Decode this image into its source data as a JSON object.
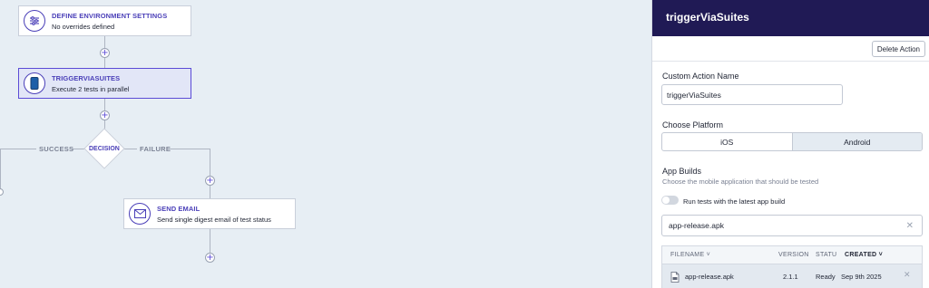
{
  "flow": {
    "nodes": [
      {
        "title": "DEFINE ENVIRONMENT SETTINGS",
        "subtitle": "No overrides defined",
        "icon": "sliders-icon"
      },
      {
        "title": "TRIGGERVIASUITES",
        "subtitle": "Execute 2 tests in parallel",
        "icon": "phone-icon"
      },
      {
        "title": "SEND EMAIL",
        "subtitle": "Send single digest email of test status",
        "icon": "envelope-icon"
      }
    ],
    "decision": {
      "label": "DECISION",
      "success_label": "SUCCESS",
      "failure_label": "FAILURE"
    },
    "add_step_glyph": "+"
  },
  "panel": {
    "title": "triggerViaSuites",
    "delete_button": "Delete Action",
    "custom_action_name": {
      "label": "Custom Action Name",
      "value": "triggerViaSuites"
    },
    "platform": {
      "label": "Choose Platform",
      "options": [
        "iOS",
        "Android"
      ],
      "selected": "Android"
    },
    "app_builds": {
      "label": "App Builds",
      "hint": "Choose the mobile application that should be tested",
      "toggle_label": "Run tests with the latest app build",
      "toggle_on": false,
      "search_value": "app-release.apk",
      "clear_glyph": "✕",
      "table": {
        "headers": {
          "filename": "FILENAME ˅",
          "version": "VERSION",
          "status": "STATU",
          "created": "CREATED ˅"
        },
        "rows": [
          {
            "filename": "app-release.apk",
            "version": "2.1.1",
            "status": "Ready",
            "created": "Sep 9th 2025",
            "remove_glyph": "✕"
          }
        ]
      }
    }
  },
  "colors": {
    "accent": "#4a3fb8",
    "header": "#201a55",
    "canvas": "#e7eef4"
  }
}
